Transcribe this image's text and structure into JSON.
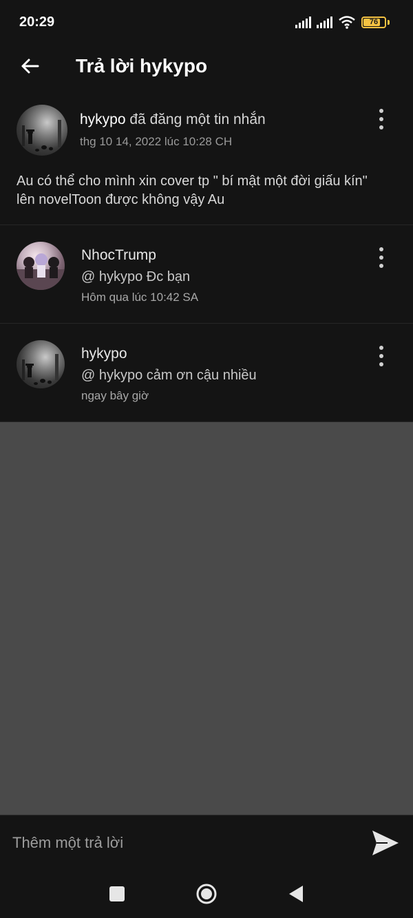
{
  "status_bar": {
    "time": "20:29",
    "battery": "76"
  },
  "app_bar": {
    "title": "Trả lời hykypo"
  },
  "post": {
    "username": "hykypo",
    "action": " đã đăng một tin nhắn",
    "date": "thg 10 14, 2022 lúc 10:28 CH",
    "body": "Au có thể cho mình xin cover tp \" bí mật một đời giấu kín\" lên novelToon được không vậy Au"
  },
  "replies": [
    {
      "name": "NhocTrump",
      "text": "@ hykypo  Đc bạn",
      "time": "Hôm qua lúc 10:42 SA"
    },
    {
      "name": "hykypo",
      "text": "@ hykypo  cảm ơn cậu nhiều",
      "time": "ngay bây giờ"
    }
  ],
  "composer": {
    "placeholder": "Thêm một trả lời"
  },
  "icons": {
    "back": "arrow-left-icon",
    "more": "more-vertical-icon",
    "send": "send-icon",
    "nav_recents": "square-icon",
    "nav_home": "circle-icon",
    "nav_back": "triangle-back-icon"
  }
}
